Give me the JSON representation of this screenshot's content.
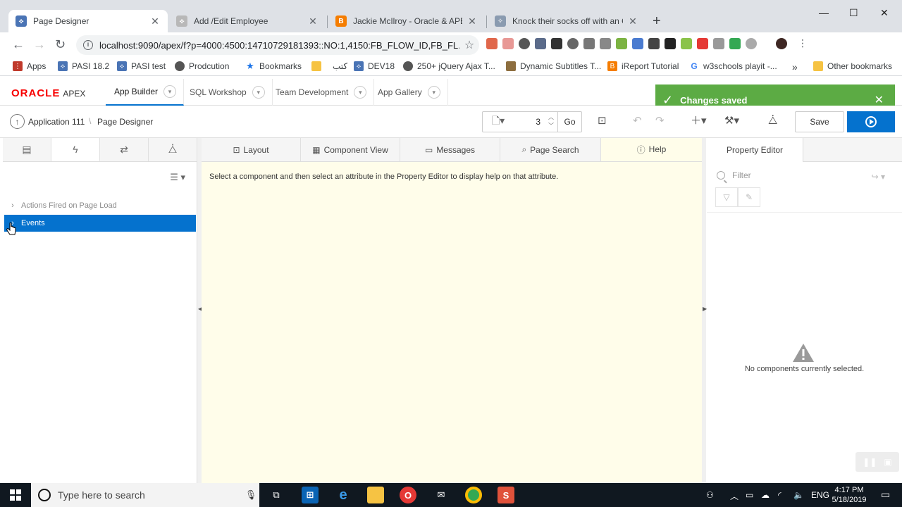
{
  "browser": {
    "tabs": [
      {
        "title": "Page Designer",
        "active": true
      },
      {
        "title": "Add /Edit Employee",
        "active": false
      },
      {
        "title": "Jackie McIlroy - Oracle & APEX: D",
        "active": false
      },
      {
        "title": "Knock their socks off with an Ora",
        "active": false
      }
    ],
    "new_tab": "+",
    "window_controls": {
      "minimize": "—",
      "maximize": "☐",
      "close": "✕"
    },
    "url": "localhost:9090/apex/f?p=4000:4500:14710729181393::NO:1,4150:FB_FLOW_ID,FB_FL...",
    "bookmarks": [
      "Apps",
      "PASI 18.2",
      "PASI test",
      "Prodcution",
      "Bookmarks",
      "كتب",
      "DEV18",
      "250+ jQuery Ajax T...",
      "Dynamic Subtitles T...",
      "iReport Tutorial",
      "w3schools playit -...",
      "»",
      "Other bookmarks"
    ]
  },
  "apex": {
    "logo_oracle": "ORACLE",
    "logo_apex": "APEX",
    "nav": [
      {
        "label": "App Builder",
        "active": true
      },
      {
        "label": "SQL Workshop",
        "active": false
      },
      {
        "label": "Team Development",
        "active": false
      },
      {
        "label": "App Gallery",
        "active": false
      }
    ],
    "toast": {
      "message": "Changes saved",
      "close": "✕"
    },
    "breadcrumb": {
      "app": "Application 111",
      "page": "Page Designer"
    },
    "page_number": "3",
    "go_label": "Go",
    "save_label": "Save"
  },
  "left_pane": {
    "tree": [
      {
        "label": "Actions Fired on Page Load",
        "selected": false
      },
      {
        "label": "Events",
        "selected": true
      }
    ]
  },
  "center_pane": {
    "tabs": [
      {
        "label": "Layout",
        "icon": "layout-icon"
      },
      {
        "label": "Component View",
        "icon": "grid-icon"
      },
      {
        "label": "Messages",
        "icon": "message-icon"
      },
      {
        "label": "Page Search",
        "icon": "search-icon"
      },
      {
        "label": "Help",
        "icon": "help-icon"
      }
    ],
    "active_tab": "Help",
    "help_text": "Select a component and then select an attribute in the Property Editor to display help on that attribute."
  },
  "right_pane": {
    "tab": "Property Editor",
    "filter_placeholder": "Filter",
    "empty_message": "No components currently selected."
  },
  "taskbar": {
    "search_placeholder": "Type here to search",
    "language": "ENG",
    "time": "4:17 PM",
    "date": "5/18/2019"
  },
  "colors": {
    "accent": "#0572ce",
    "toast": "#5cab44",
    "help_bg": "#fffdea",
    "oracle_red": "#f80000"
  }
}
